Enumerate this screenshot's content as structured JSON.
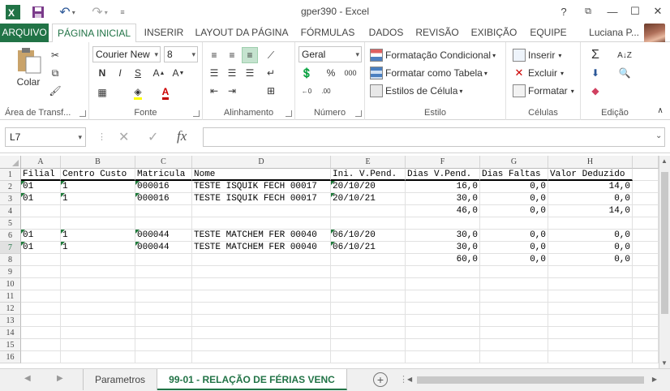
{
  "title": "gper390 - Excel",
  "window": {
    "help": "?",
    "restore": "⧉",
    "minimize": "—",
    "maximize": "☐",
    "close": "✕"
  },
  "tabs": [
    "ARQUIVO",
    "PÁGINA INICIAL",
    "INSERIR",
    "LAYOUT DA PÁGINA",
    "FÓRMULAS",
    "DADOS",
    "REVISÃO",
    "EXIBIÇÃO",
    "EQUIPE"
  ],
  "user": "Luciana P...",
  "ribbon": {
    "clipboard": {
      "paste": "Colar",
      "label": "Área de Transf..."
    },
    "font": {
      "name": "Courier New",
      "size": "8",
      "bold": "N",
      "italic": "I",
      "underline": "S",
      "label": "Fonte"
    },
    "alignment": {
      "label": "Alinhamento"
    },
    "number": {
      "format": "Geral",
      "label": "Número"
    },
    "styles": {
      "conditional": "Formatação Condicional",
      "table": "Formatar como Tabela",
      "cell": "Estilos de Célula",
      "label": "Estilo"
    },
    "cells": {
      "insert": "Inserir",
      "delete": "Excluir",
      "format": "Formatar",
      "label": "Células"
    },
    "editing": {
      "label": "Edição"
    }
  },
  "formula_bar": {
    "name_box": "L7",
    "fx": "fx",
    "value": ""
  },
  "columns": [
    "A",
    "B",
    "C",
    "D",
    "E",
    "F",
    "G",
    "H"
  ],
  "rows": [
    {
      "n": "1",
      "cells": [
        "Filial",
        "Centro Custo",
        "Matricula",
        "Nome",
        "Ini. V.Pend.",
        "Dias V.Pend.",
        "Dias Faltas",
        "Valor Deduzido"
      ]
    },
    {
      "n": "2",
      "cells": [
        "01",
        "1",
        "000016",
        "TESTE ISQUIK FECH 00017",
        "20/10/20",
        "16,0",
        "0,0",
        "14,0"
      ]
    },
    {
      "n": "3",
      "cells": [
        "01",
        "1",
        "000016",
        "TESTE ISQUIK FECH 00017",
        "20/10/21",
        "30,0",
        "0,0",
        "0,0"
      ]
    },
    {
      "n": "4",
      "cells": [
        "",
        "",
        "",
        "",
        "",
        "46,0",
        "0,0",
        "14,0"
      ]
    },
    {
      "n": "5",
      "cells": [
        "",
        "",
        "",
        "",
        "",
        "",
        "",
        ""
      ]
    },
    {
      "n": "6",
      "cells": [
        "01",
        "1",
        "000044",
        "TESTE MATCHEM FER 00040",
        "06/10/20",
        "30,0",
        "0,0",
        "0,0"
      ]
    },
    {
      "n": "7",
      "cells": [
        "01",
        "1",
        "000044",
        "TESTE MATCHEM FER 00040",
        "06/10/21",
        "30,0",
        "0,0",
        "0,0"
      ]
    },
    {
      "n": "8",
      "cells": [
        "",
        "",
        "",
        "",
        "",
        "60,0",
        "0,0",
        "0,0"
      ]
    },
    {
      "n": "9",
      "cells": [
        "",
        "",
        "",
        "",
        "",
        "",
        "",
        ""
      ]
    },
    {
      "n": "10",
      "cells": [
        "",
        "",
        "",
        "",
        "",
        "",
        "",
        ""
      ]
    },
    {
      "n": "11",
      "cells": [
        "",
        "",
        "",
        "",
        "",
        "",
        "",
        ""
      ]
    },
    {
      "n": "12",
      "cells": [
        "",
        "",
        "",
        "",
        "",
        "",
        "",
        ""
      ]
    },
    {
      "n": "13",
      "cells": [
        "",
        "",
        "",
        "",
        "",
        "",
        "",
        ""
      ]
    },
    {
      "n": "14",
      "cells": [
        "",
        "",
        "",
        "",
        "",
        "",
        "",
        ""
      ]
    },
    {
      "n": "15",
      "cells": [
        "",
        "",
        "",
        "",
        "",
        "",
        "",
        ""
      ]
    },
    {
      "n": "16",
      "cells": [
        "",
        "",
        "",
        "",
        "",
        "",
        "",
        ""
      ]
    }
  ],
  "sheets": [
    "Parametros",
    "99-01 - RELAÇÃO DE FÉRIAS VENC"
  ],
  "colors": {
    "accent": "#217346"
  }
}
